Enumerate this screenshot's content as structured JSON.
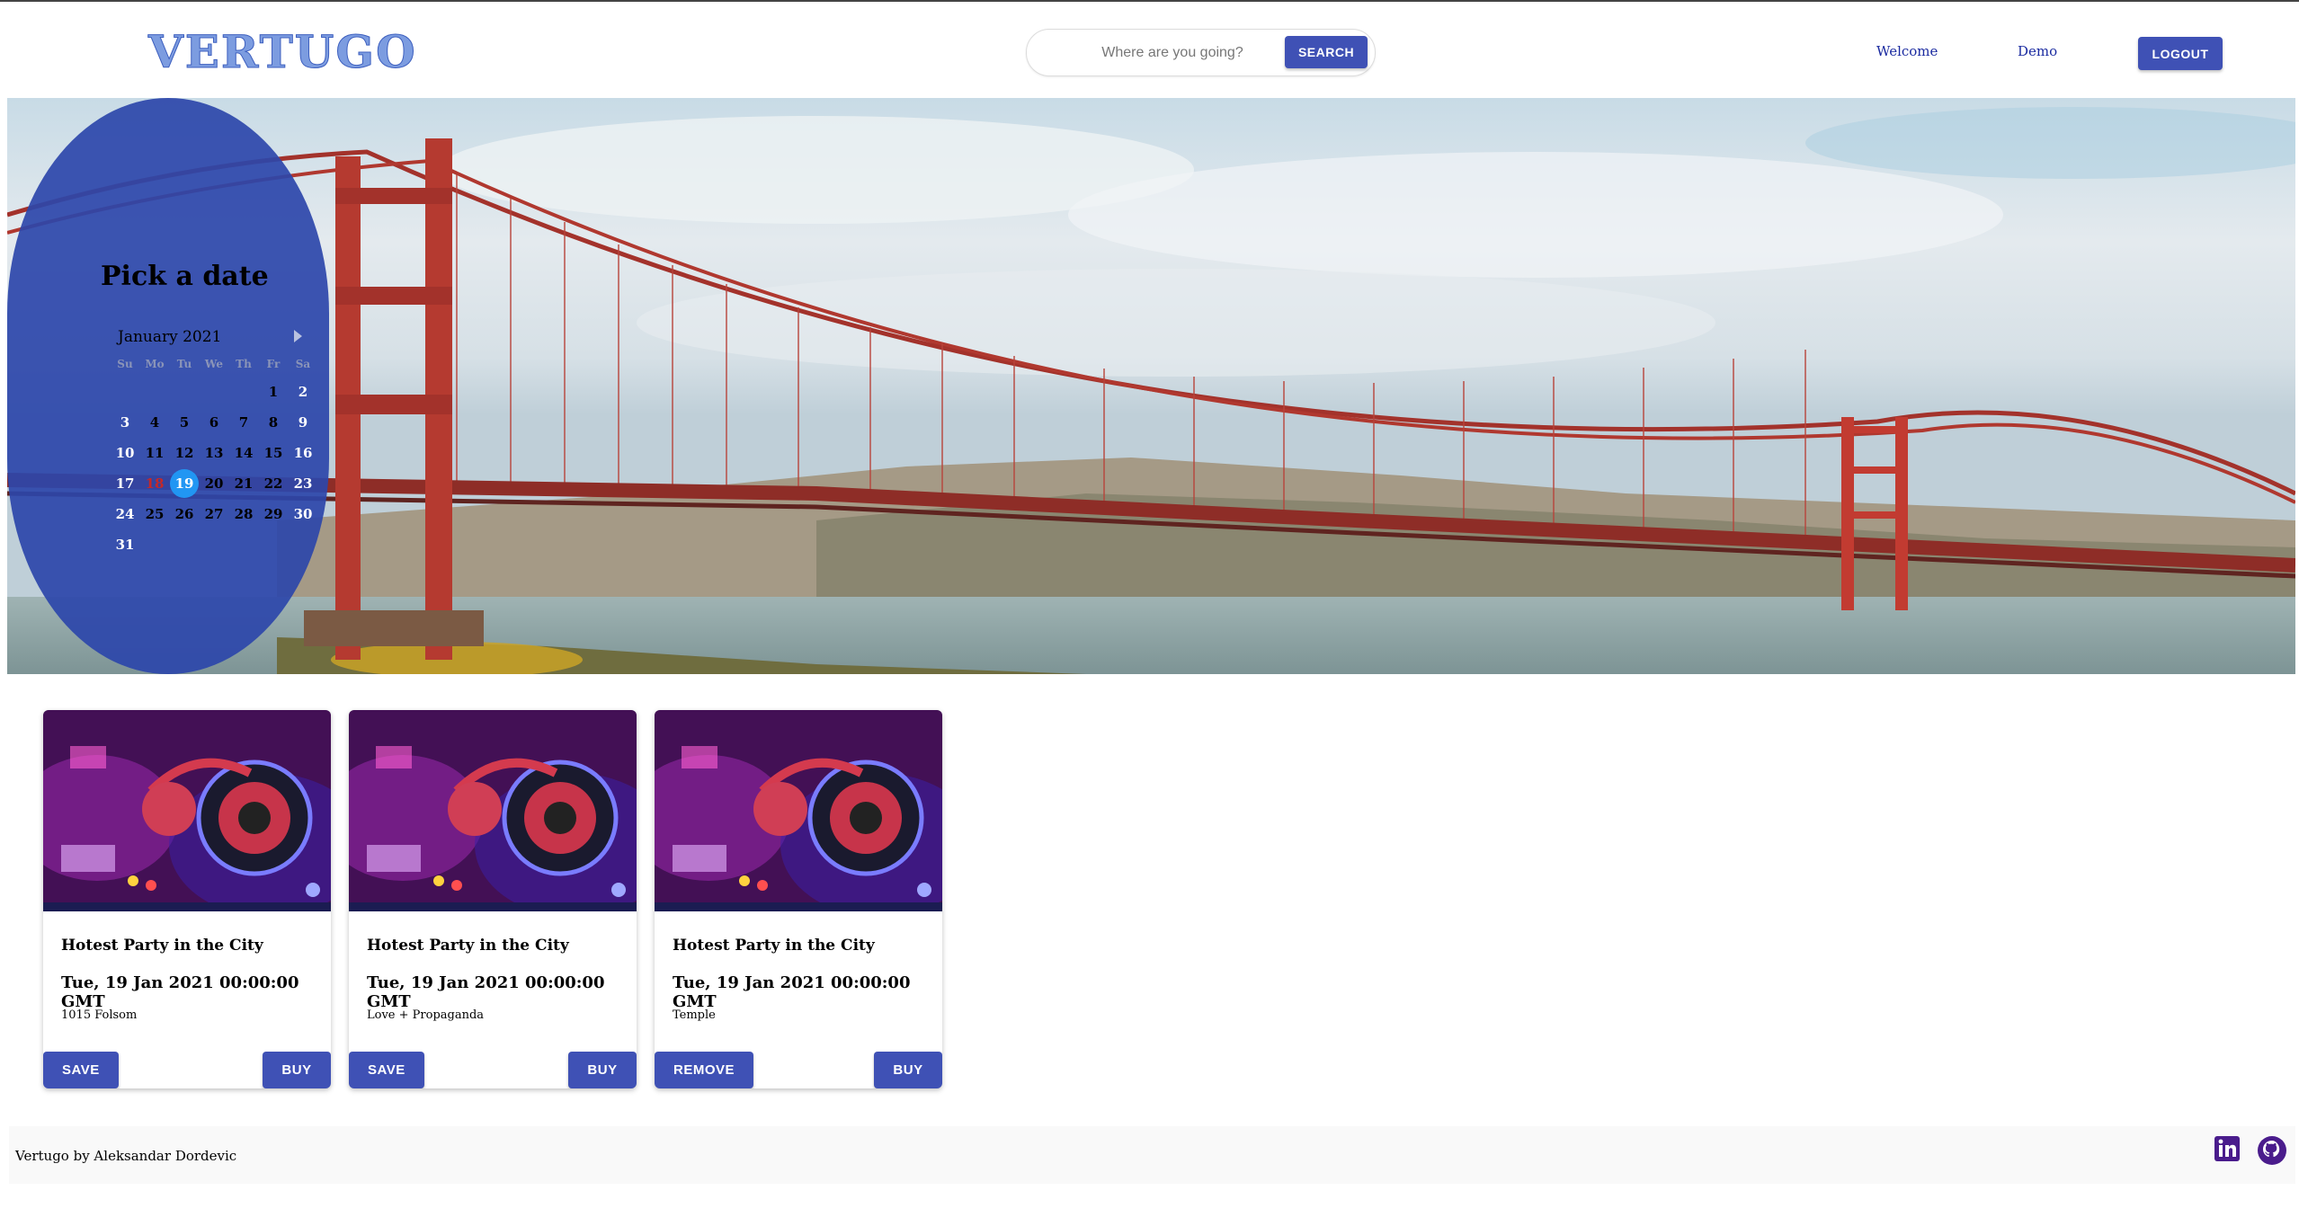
{
  "header": {
    "logo": "VERTUGO",
    "search_placeholder": "Where are you going?",
    "search_button": "SEARCH",
    "nav_welcome": "Welcome",
    "nav_user": "Demo",
    "logout_button": "LOGOUT"
  },
  "calendar": {
    "title": "Pick a date",
    "month": "January 2021",
    "weekdays": [
      "Su",
      "Mo",
      "Tu",
      "We",
      "Th",
      "Fr",
      "Sa"
    ],
    "selected_day": 19,
    "today_day": 18
  },
  "cards": [
    {
      "title": "Hotest Party in the City",
      "date": "Tue, 19 Jan 2021 00:00:00 GMT",
      "venue": "1015 Folsom",
      "left_button": "SAVE",
      "right_button": "BUY"
    },
    {
      "title": "Hotest Party in the City",
      "date": "Tue, 19 Jan 2021 00:00:00 GMT",
      "venue": "Love + Propaganda",
      "left_button": "SAVE",
      "right_button": "BUY"
    },
    {
      "title": "Hotest Party in the City",
      "date": "Tue, 19 Jan 2021 00:00:00 GMT",
      "venue": "Temple",
      "left_button": "REMOVE",
      "right_button": "BUY"
    }
  ],
  "footer": {
    "credit": "Vertugo by Aleksandar Dordevic",
    "icons": [
      "linkedin-icon",
      "github-icon"
    ]
  },
  "colors": {
    "primary": "#3f51b5",
    "calendar_panel": "#2d46aa",
    "selected_day": "#2196f3",
    "nav_link": "#1a2aa0"
  }
}
